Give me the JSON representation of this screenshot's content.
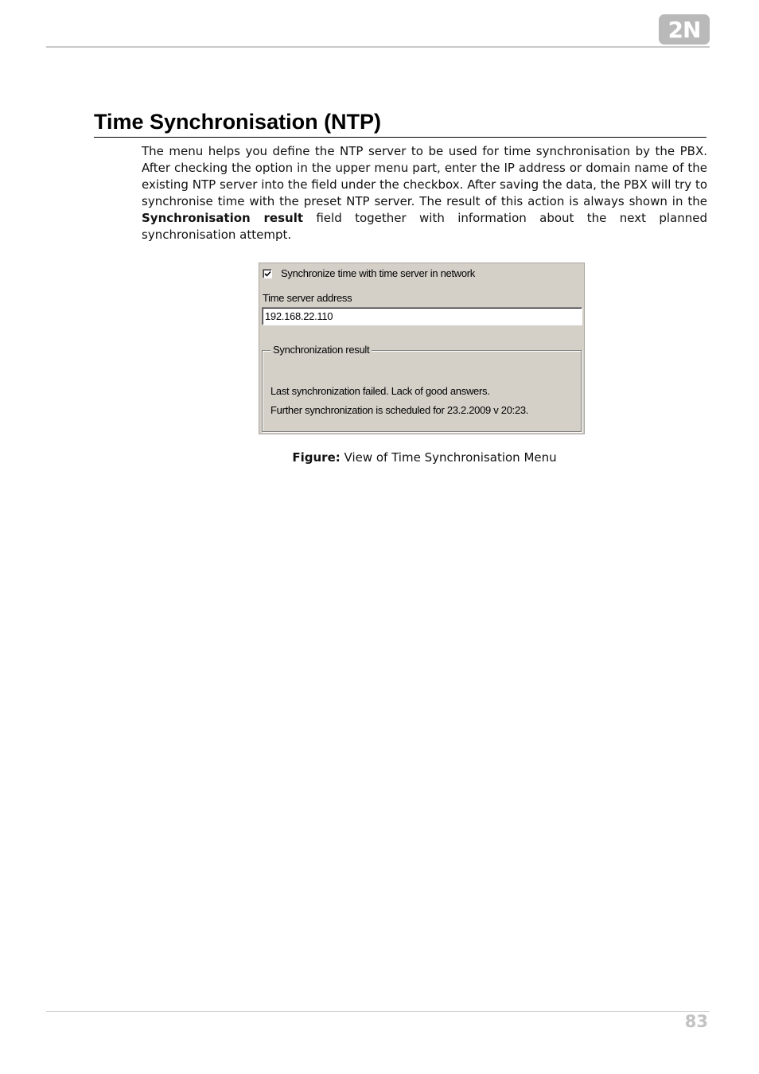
{
  "header": {
    "logo_text": "2N"
  },
  "content": {
    "title": "Time Synchronisation (NTP)",
    "paragraph_part1": "The menu helps you define the NTP server to be used for time synchronisation by the PBX. After checking the option in the upper menu part, enter the IP address or domain name of the existing NTP server into the field under the checkbox. After saving the data, the PBX will try to synchronise time with the preset NTP server. The result of this action is always shown in the ",
    "paragraph_bold": "Synchronisation result",
    "paragraph_part2": " field together with information about the next planned synchronisation attempt."
  },
  "figure": {
    "checkbox_label": "Synchronize time with time server in network",
    "checkbox_checked": true,
    "server_label": "Time server address",
    "server_value": "192.168.22.110",
    "group_title": "Synchronization result",
    "result_line1": "Last synchronization failed. Lack of good answers.",
    "result_line2": "Further synchronization is scheduled for 23.2.2009 v 20:23.",
    "panel_color": "#d4d0c8",
    "caption_bold": "Figure:",
    "caption_text": " View of Time Synchronisation Menu"
  },
  "footer": {
    "page_number": "83"
  }
}
